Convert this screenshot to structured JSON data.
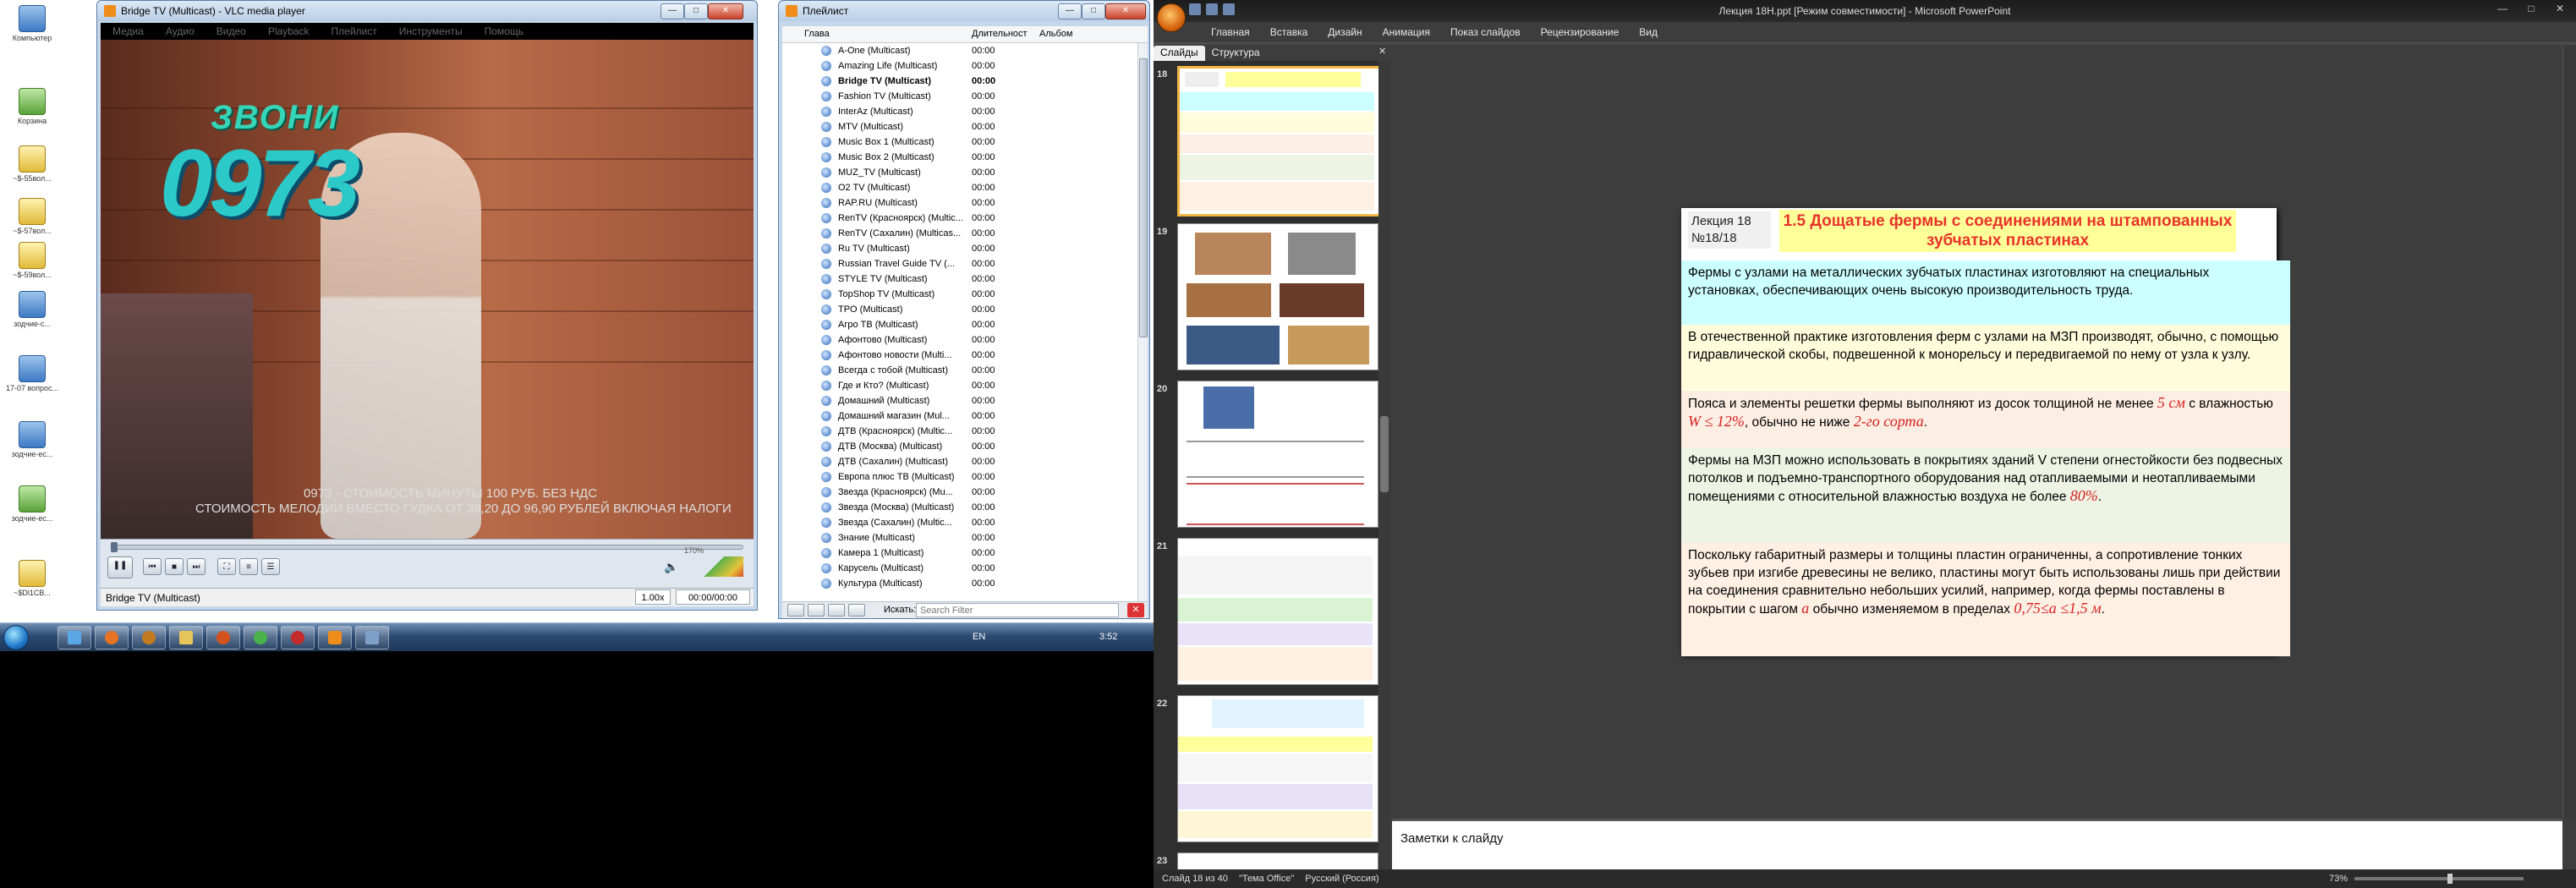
{
  "desktop": {
    "icons": [
      {
        "label": "Компьютер"
      },
      {
        "label": "Корзина"
      },
      {
        "label": "~$-55вол..."
      },
      {
        "label": "~$-57вол..."
      },
      {
        "label": "~$-59вол..."
      },
      {
        "label": "зодчие-с..."
      },
      {
        "label": "17-07 вопрос..."
      },
      {
        "label": "зодчие-ес..."
      },
      {
        "label": "зодчие-ес..."
      },
      {
        "label": "~$Dl1СВ..."
      }
    ]
  },
  "taskbar": {
    "lang": "EN",
    "clock": "3:52"
  },
  "vlc": {
    "title": "Bridge TV (Multicast) - VLC media player",
    "menu": [
      "Медиа",
      "Аудио",
      "Видео",
      "Playback",
      "Плейлист",
      "Инструменты",
      "Помощь"
    ],
    "video_texts": {
      "zvoni": "ЗВОНИ",
      "number": "0973",
      "caption1": "0973 - СТОИМОСТЬ МИНУТЫ 100 РУБ. БЕЗ НДС",
      "caption2": "СТОИМОСТЬ МЕЛОДИИ ВМЕСТО ГУДКА ОТ 38,20 ДО 96,90 РУБЛЕЙ ВКЛЮЧАЯ НАЛОГИ"
    },
    "volume_label": "170%",
    "status_name": "Bridge TV (Multicast)",
    "speed": "1.00x",
    "time": "00:00/00:00"
  },
  "playlist": {
    "title": "Плейлист",
    "columns": {
      "name": "Глава",
      "duration": "Длительност",
      "album": "Альбом"
    },
    "current_index": 2,
    "items": [
      {
        "name": "A-One (Multicast)",
        "dur": "00:00"
      },
      {
        "name": "Amazing Life (Multicast)",
        "dur": "00:00"
      },
      {
        "name": "Bridge TV (Multicast)",
        "dur": "00:00"
      },
      {
        "name": "Fashion TV (Multicast)",
        "dur": "00:00"
      },
      {
        "name": "InterAz (Multicast)",
        "dur": "00:00"
      },
      {
        "name": "MTV (Multicast)",
        "dur": "00:00"
      },
      {
        "name": "Music Box 1 (Multicast)",
        "dur": "00:00"
      },
      {
        "name": "Music Box 2 (Multicast)",
        "dur": "00:00"
      },
      {
        "name": "MUZ_TV (Multicast)",
        "dur": "00:00"
      },
      {
        "name": "O2 TV (Multicast)",
        "dur": "00:00"
      },
      {
        "name": "RAP.RU (Multicast)",
        "dur": "00:00"
      },
      {
        "name": "RenTV (Красноярск) (Multic...",
        "dur": "00:00"
      },
      {
        "name": "RenTV (Сахалин) (Multicas...",
        "dur": "00:00"
      },
      {
        "name": "Ru TV (Multicast)",
        "dur": "00:00"
      },
      {
        "name": "Russian Travel Guide TV (...",
        "dur": "00:00"
      },
      {
        "name": "STYLE TV (Multicast)",
        "dur": "00:00"
      },
      {
        "name": "TopShop TV (Multicast)",
        "dur": "00:00"
      },
      {
        "name": "TPO (Multicast)",
        "dur": "00:00"
      },
      {
        "name": "Агро ТВ (Multicast)",
        "dur": "00:00"
      },
      {
        "name": "Афонтово (Multicast)",
        "dur": "00:00"
      },
      {
        "name": "Афонтово новости (Multi...",
        "dur": "00:00"
      },
      {
        "name": "Всегда с тобой (Multicast)",
        "dur": "00:00"
      },
      {
        "name": "Где и Кто? (Multicast)",
        "dur": "00:00"
      },
      {
        "name": "Домашний (Multicast)",
        "dur": "00:00"
      },
      {
        "name": "Домашний магазин (Mul...",
        "dur": "00:00"
      },
      {
        "name": "ДТВ (Красноярск) (Multic...",
        "dur": "00:00"
      },
      {
        "name": "ДТВ (Москва) (Multicast)",
        "dur": "00:00"
      },
      {
        "name": "ДТВ (Сахалин) (Multicast)",
        "dur": "00:00"
      },
      {
        "name": "Европа плюс ТВ (Multicast)",
        "dur": "00:00"
      },
      {
        "name": "Звезда (Красноярск) (Mu...",
        "dur": "00:00"
      },
      {
        "name": "Звезда (Москва) (Multicast)",
        "dur": "00:00"
      },
      {
        "name": "Звезда (Сахалин) (Multic...",
        "dur": "00:00"
      },
      {
        "name": "Знание (Multicast)",
        "dur": "00:00"
      },
      {
        "name": "Камера 1 (Multicast)",
        "dur": "00:00"
      },
      {
        "name": "Карусель (Multicast)",
        "dur": "00:00"
      },
      {
        "name": "Культура (Multicast)",
        "dur": "00:00"
      }
    ],
    "search_label": "Искать:",
    "search_placeholder": "Search Filter",
    "clear_label": "✕"
  },
  "ppt": {
    "title": "Лекция 18Н.ppt [Режим совместимости] - Microsoft PowerPoint",
    "tabs": [
      "Главная",
      "Вставка",
      "Дизайн",
      "Анимация",
      "Показ слайдов",
      "Рецензирование",
      "Вид"
    ],
    "panel_tabs": [
      "Слайды",
      "Структура"
    ],
    "thumb_numbers": [
      "18",
      "19",
      "20",
      "21",
      "22",
      "23"
    ],
    "notes_placeholder": "Заметки к слайду",
    "status": {
      "slide": "Слайд 18 из 40",
      "theme": "\"Тема Office\"",
      "lang": "Русский (Россия)",
      "zoom": "73%"
    },
    "slide": {
      "lecture_line1": "Лекция 18",
      "lecture_line2": "№18/18",
      "title": "1.5 Дощатые фермы с соединениями на штампованных зубчатых пластинах",
      "p1": "Фермы с узлами на металлических зубчатых пластинах изготовляют на специальных установках, обеспечивающих очень высокую производительность труда.",
      "p2": "В отечественной практике изготовления ферм с узлами на МЗП производят, обычно, с помощью гидравлической скобы, подвешенной к монорельсу и передвигаемой по нему от узла к узлу.",
      "p3a": "Пояса и элементы решетки фермы выполняют из досок толщиной не менее ",
      "p3b": "5 см",
      "p3c": " с влажностью ",
      "p3d": "W ≤ 12%",
      "p3e": ", обычно не ниже ",
      "p3f": "2-го сорта",
      "p3g": ".",
      "p4a": "Фермы на МЗП можно использовать в покрытиях зданий V степени огнестойкости без подвесных потолков и подъемно-транспортного оборудования над отапливаемыми и неотапливаемыми помещениями с относительной влажностью воздуха не более ",
      "p4b": "80%",
      "p4c": ".",
      "p5a": "Поскольку габаритный размеры и толщины пластин ограниченны, а сопротивление тонких зубьев при изгибе древесины не велико, пластины могут быть использованы лишь при действии на соединения сравнительно небольших усилий, например, когда фермы поставлены в покрытии с шагом ",
      "p5b": "a",
      "p5c": "  обычно изменяемом в пределах ",
      "p5d": "0,75≤a ≤1,5  м",
      "p5e": "."
    }
  }
}
